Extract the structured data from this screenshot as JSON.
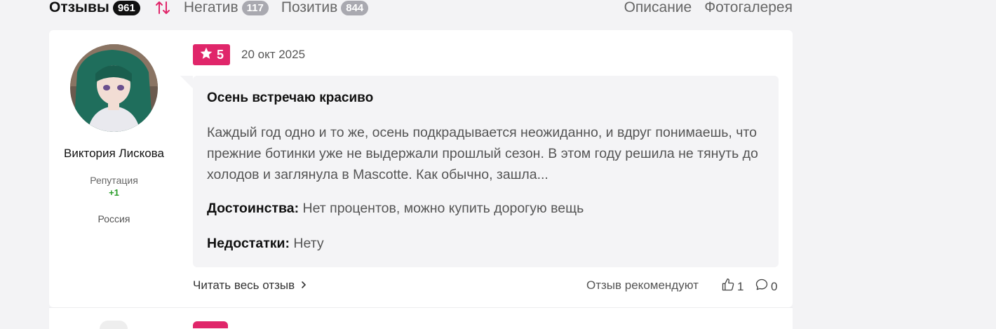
{
  "tabs": {
    "reviews_label": "Отзывы",
    "reviews_count": "961",
    "negative_label": "Негатив",
    "negative_count": "117",
    "positive_label": "Позитив",
    "positive_count": "844",
    "description_label": "Описание",
    "gallery_label": "Фотогалерея"
  },
  "review": {
    "author_name": "Виктория Лискова",
    "reputation_label": "Репутация",
    "reputation_value": "+1",
    "country": "Россия",
    "rating": "5",
    "date": "20 окт 2025",
    "title": "Осень встречаю красиво",
    "text": "Каждый год одно и то же, осень подкрадывается неожиданно, и вдруг понимаешь, что прежние ботинки уже не выдержали прошлый сезон. В этом году решила не тянуть до холодов и заглянула в Mascotte. Как обычно, зашла...",
    "pros_label": "Достоинства:",
    "pros_text": "Нет процентов, можно купить дорогую вещь",
    "cons_label": "Недостатки:",
    "cons_text": "Нету",
    "read_more": "Читать весь отзыв",
    "recommend_label": "Отзыв рекомендуют",
    "likes": "1",
    "comments": "0"
  },
  "colors": {
    "accent": "#e0266a",
    "reputation": "#2a9d2a"
  },
  "icons": [
    "sort-icon",
    "star-icon",
    "chevron-right-icon",
    "thumbs-up-icon",
    "comment-icon"
  ]
}
